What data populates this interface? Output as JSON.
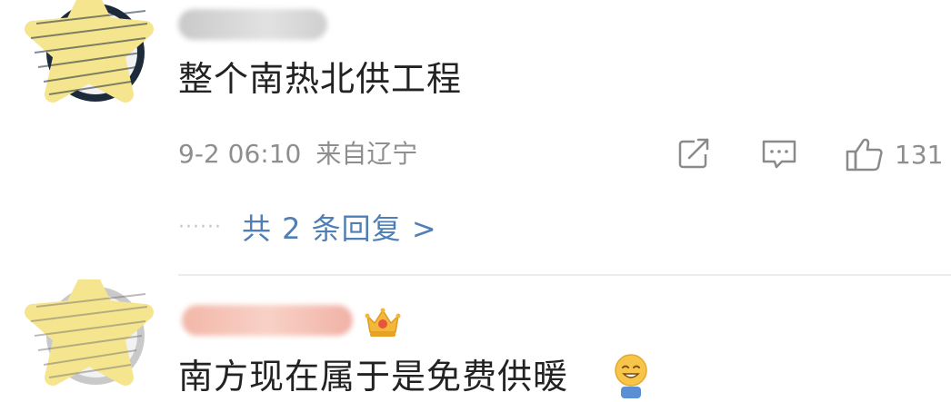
{
  "comments": [
    {
      "text": "整个南热北供工程",
      "timestamp": "9-2 06:10",
      "location": "来自辽宁",
      "likes": "131",
      "replies_label": "共 2 条回复 >",
      "avatar": "star-avatar",
      "username_redacted": true
    },
    {
      "text": "南方现在属于是免费供暖",
      "avatar": "star-avatar",
      "badge": "crown-badge-icon",
      "emoji": "grinning-emoji",
      "username_redacted": true
    }
  ],
  "icons": {
    "share": "share-icon",
    "reply": "comment-icon",
    "like": "thumbs-up-icon"
  },
  "colors": {
    "link": "#4f7fb5",
    "meta": "#8e8e8e",
    "avatar_star": "#f5e58f"
  }
}
